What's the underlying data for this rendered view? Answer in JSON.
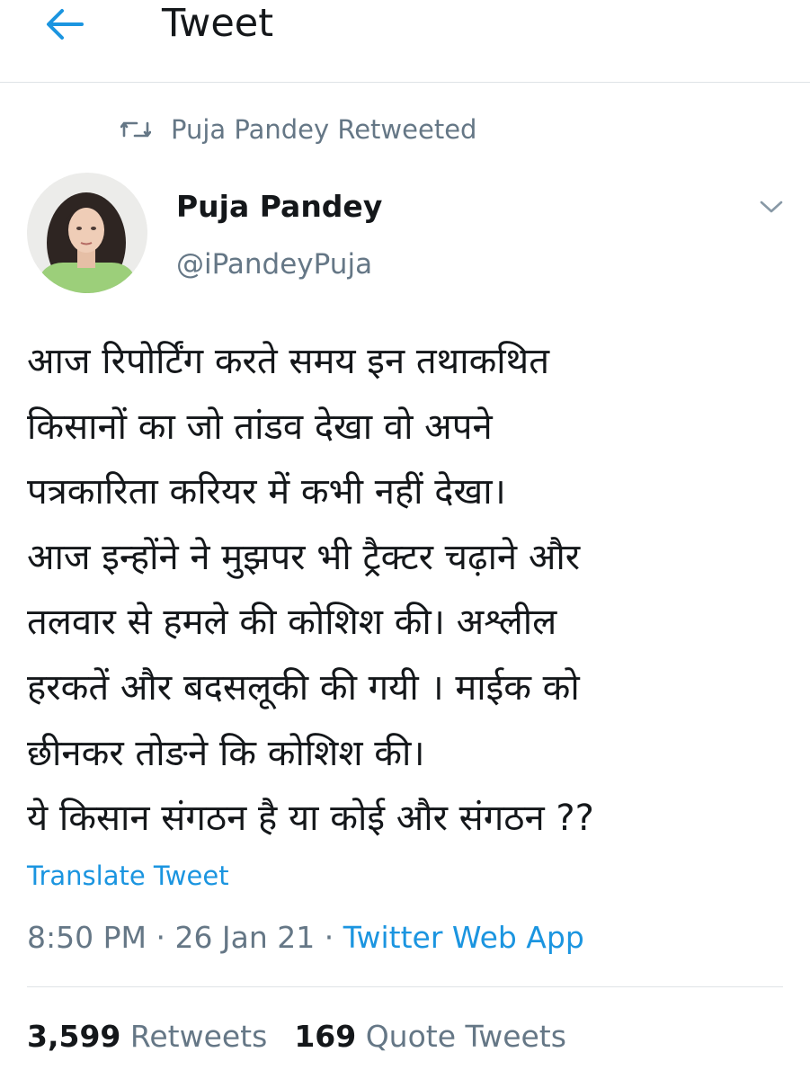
{
  "header": {
    "title": "Tweet",
    "back_icon": "back-arrow-icon"
  },
  "retweet_context": {
    "icon": "retweet-icon",
    "text": "Puja Pandey Retweeted"
  },
  "author": {
    "name": "Puja Pandey",
    "handle": "@iPandeyPuja"
  },
  "tweet": {
    "lines": [
      "आज रिपोर्टिंग करते समय इन तथाकथित",
      "किसानों का जो तांडव देखा वो अपने",
      "पत्रकारिता करियर में कभी नहीं देखा।",
      "आज इन्होंने ने मुझपर भी ट्रैक्टर चढ़ाने और",
      "तलवार से हमले की कोशिश की। अश्लील",
      "हरकतें और बदसलूकी की गयी । माईक को",
      "छीनकर तोङने कि कोशिश की।",
      "ये किसान संगठन है या कोई और संगठन ??"
    ],
    "translate_label": "Translate Tweet"
  },
  "meta": {
    "time": "8:50 PM",
    "separator": " · ",
    "date": "26 Jan 21",
    "source": "Twitter Web App"
  },
  "stats": {
    "retweets_count": "3,599",
    "retweets_label": "Retweets",
    "quotes_count": "169",
    "quotes_label": "Quote Tweets"
  },
  "colors": {
    "accent": "#1b95e0",
    "secondary_text": "#657786",
    "primary_text": "#14171a",
    "divider": "#dfe3e7"
  }
}
